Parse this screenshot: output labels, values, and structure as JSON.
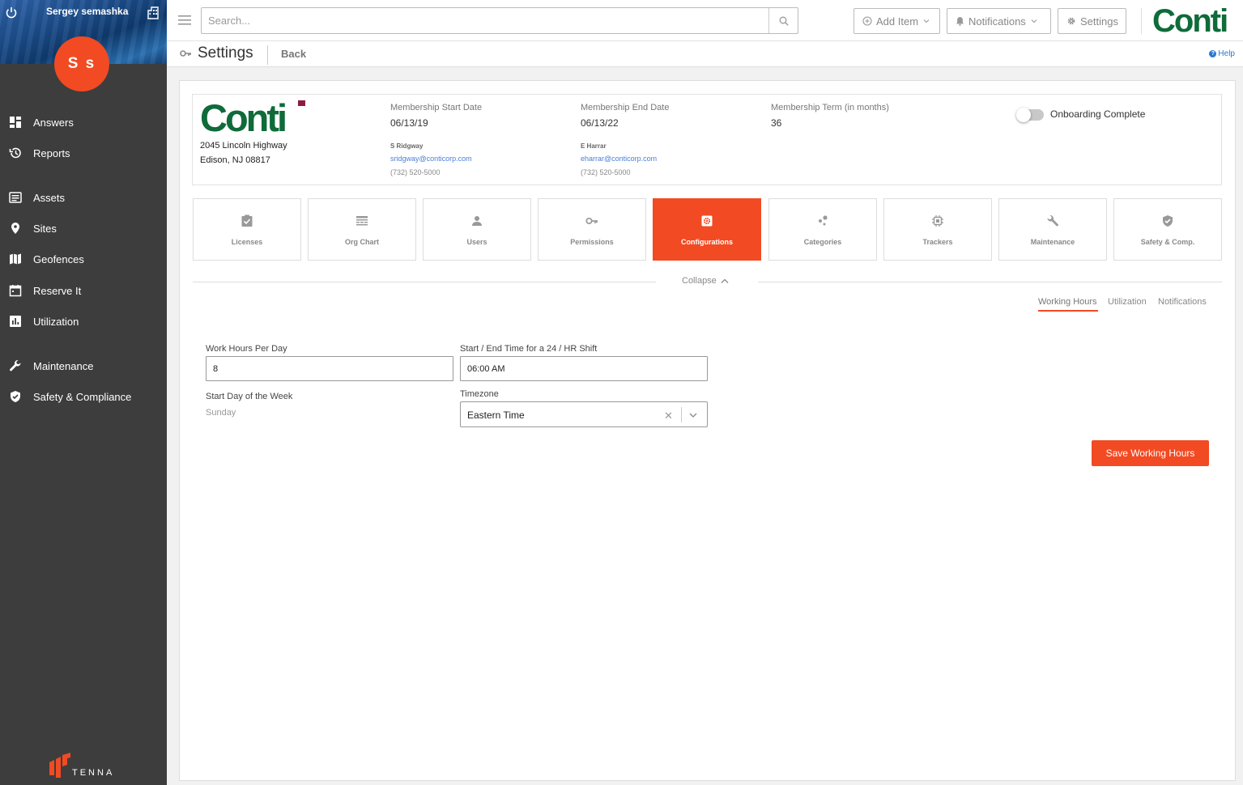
{
  "sidebar": {
    "user_name": "Sergey semashka",
    "avatar_initials": "S s",
    "nav": [
      {
        "label": "Answers",
        "icon": "dashboard-icon"
      },
      {
        "label": "Reports",
        "icon": "history-icon"
      },
      {
        "label": "Assets",
        "icon": "list-icon"
      },
      {
        "label": "Sites",
        "icon": "location-pin-icon"
      },
      {
        "label": "Geofences",
        "icon": "map-icon"
      },
      {
        "label": "Reserve It",
        "icon": "calendar-icon"
      },
      {
        "label": "Utilization",
        "icon": "bar-chart-icon"
      },
      {
        "label": "Maintenance",
        "icon": "wrench-icon"
      },
      {
        "label": "Safety & Compliance",
        "icon": "shield-icon"
      }
    ],
    "footer_logo": "TENNA"
  },
  "topbar": {
    "search_placeholder": "Search...",
    "add_item": "Add Item",
    "notifications": "Notifications",
    "settings": "Settings",
    "brand": "Conti"
  },
  "page": {
    "title": "Settings",
    "back": "Back",
    "help": "Help"
  },
  "company": {
    "logo_text": "Conti",
    "address_line1": "2045 Lincoln Highway",
    "address_line2": "Edison, NJ 08817",
    "start_label": "Membership Start Date",
    "start_value": "06/13/19",
    "end_label": "Membership End Date",
    "end_value": "06/13/22",
    "term_label": "Membership Term (in months)",
    "term_value": "36",
    "contact1": {
      "name": "S Ridgway",
      "email": "sridgway@conticorp.com",
      "phone": "(732) 520-5000"
    },
    "contact2": {
      "name": "E Harrar",
      "email": "eharrar@conticorp.com",
      "phone": "(732) 520-5000"
    },
    "onboarding_label": "Onboarding Complete",
    "onboarding_complete": false
  },
  "tiles": [
    {
      "label": "Licenses",
      "icon": "license-check-icon"
    },
    {
      "label": "Org Chart",
      "icon": "org-chart-icon"
    },
    {
      "label": "Users",
      "icon": "user-icon"
    },
    {
      "label": "Permissions",
      "icon": "key-icon"
    },
    {
      "label": "Configurations",
      "icon": "gear-icon",
      "active": true
    },
    {
      "label": "Categories",
      "icon": "categories-icon"
    },
    {
      "label": "Trackers",
      "icon": "chip-icon"
    },
    {
      "label": "Maintenance",
      "icon": "wrench-icon"
    },
    {
      "label": "Safety & Comp.",
      "icon": "shield-check-icon"
    }
  ],
  "collapse_label": "Collapse",
  "subtabs": [
    {
      "label": "Working Hours",
      "active": true
    },
    {
      "label": "Utilization"
    },
    {
      "label": "Notifications"
    }
  ],
  "form": {
    "work_hours_label": "Work Hours Per Day",
    "work_hours_value": "8",
    "shift_label": "Start / End Time for a 24 / HR Shift",
    "shift_value": "06:00 AM",
    "start_day_label": "Start Day of the Week",
    "start_day_value": "Sunday",
    "timezone_label": "Timezone",
    "timezone_value": "Eastern Time",
    "save_label": "Save Working Hours"
  },
  "colors": {
    "accent": "#f24a22",
    "sidebar_bg": "#3d3d3d",
    "brand_green": "#0f6b3a",
    "link_blue": "#4a7fd6"
  }
}
